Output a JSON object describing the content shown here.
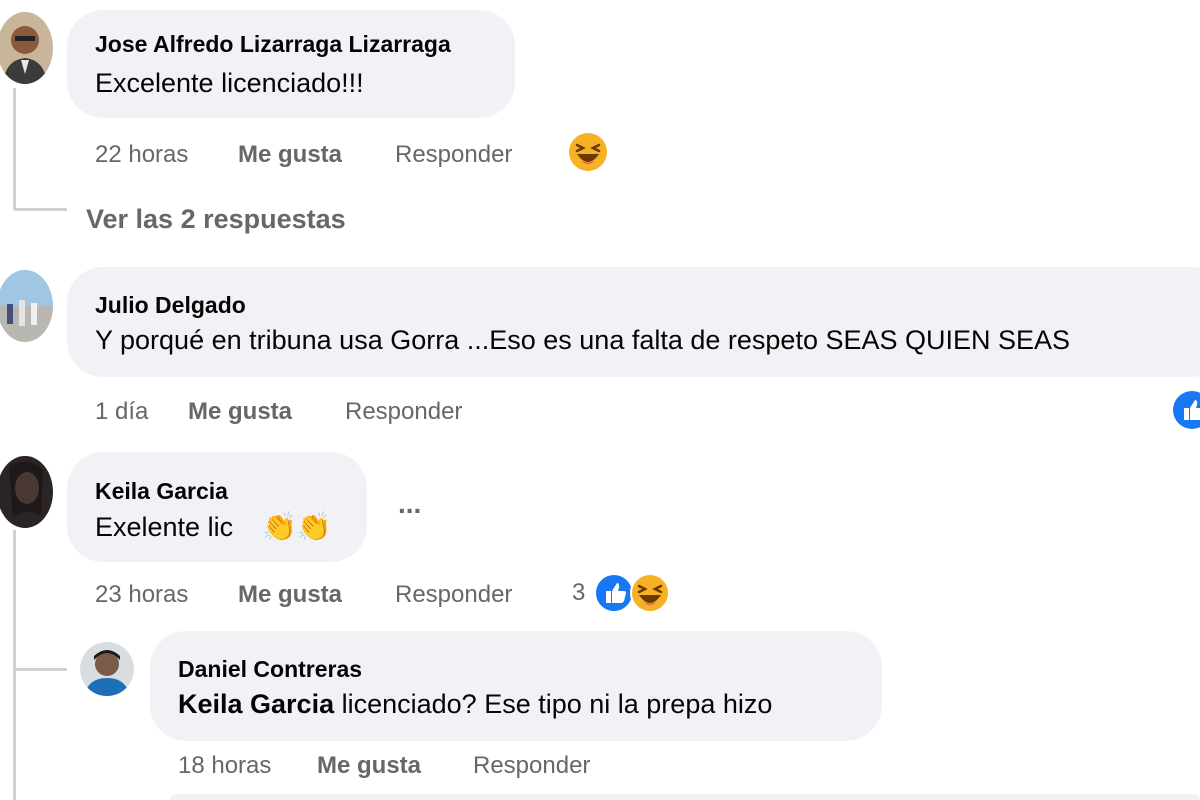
{
  "comments": [
    {
      "author": "Jose Alfredo Lizarraga Lizarraga",
      "text": "Excelente licenciado!!!",
      "time": "22 horas",
      "like_label": "Me gusta",
      "reply_label": "Responder",
      "reactions": [
        "laugh-emoji"
      ],
      "view_replies": "Ver las 2 respuestas"
    },
    {
      "author": "Julio Delgado",
      "text": "Y porqué en tribuna usa Gorra ...Eso es una falta de respeto SEAS QUIEN SEAS",
      "time": "1 día",
      "like_label": "Me gusta",
      "reply_label": "Responder",
      "reactions": [
        "like-emoji"
      ]
    },
    {
      "author": "Keila Garcia",
      "text": "Exelente lic",
      "text_emoji": "👏👏",
      "more_label": "...",
      "time": "23 horas",
      "like_label": "Me gusta",
      "reply_label": "Responder",
      "reaction_count": "3",
      "reactions": [
        "like-emoji",
        "laugh-emoji"
      ]
    }
  ],
  "replies": [
    {
      "author": "Daniel Contreras",
      "mention": "Keila Garcia",
      "text": "licenciado? Ese tipo ni la prepa hizo",
      "time": "18 horas",
      "like_label": "Me gusta",
      "reply_label": "Responder"
    }
  ],
  "colors": {
    "bubble": "#f0f2f5",
    "meta_text": "#65676b",
    "thread_line": "#ced0d4",
    "like_blue": "#1877f2",
    "laugh_yellow": "#f7b125"
  }
}
